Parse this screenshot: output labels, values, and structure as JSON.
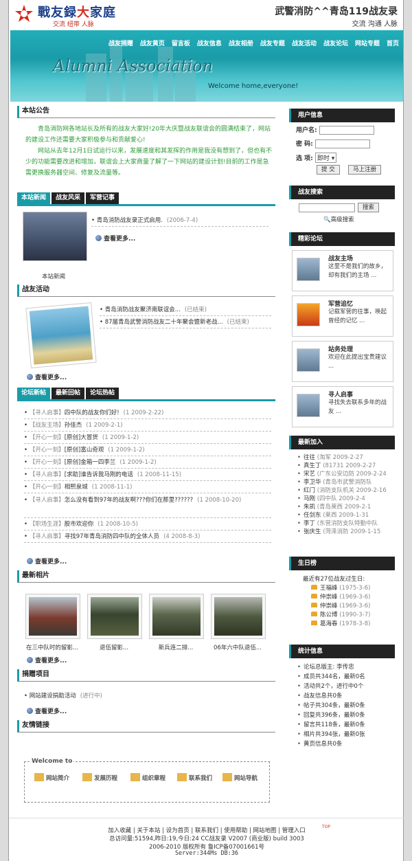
{
  "header": {
    "logo_main": "戰友録",
    "logo_accent": "大",
    "logo_end": "家庭",
    "logo_sub": "交流  纽带  人脉",
    "site_title": "武警消防^^青岛119战友录",
    "site_sub": "交流 沟通 人脉"
  },
  "nav": [
    "战友捐赠",
    "战友黄页",
    "留言板",
    "战友信息",
    "战友相册",
    "战友专题",
    "战友活动",
    "战友论坛",
    "网站专题",
    "首页"
  ],
  "banner": {
    "title": "Alumni Association",
    "welcome": "Welcome home,everyone!"
  },
  "notice": {
    "title": "本站公告",
    "p1": "青岛消防网各地站长及所有的战友大家好!20年大庆暨战友联谊会的圆满结束了，网站的建设工作还需要大家积极参与和贡献爱心!",
    "p2": "网站从去年12月1日试运行以来，发展速度和其发挥的作用是我没有想到了，但也有不少的功能需要改进和增加，联谊会上大家商量了解了一下网站的建设计划!目前的工作是急需更换服务器空间、修复及流量等。"
  },
  "news_tabs": [
    "本站新闻",
    "战友风采",
    "军营记事"
  ],
  "news": {
    "items": [
      {
        "text": "青岛消防战友录正式启用.",
        "date": "(2006-7-4)"
      }
    ],
    "more": "查看更多...",
    "img_caption": "本站新闻"
  },
  "activity": {
    "title": "战友活动",
    "items": [
      {
        "text": "青岛消防战友聚济南联谊会...",
        "status": "(已结束)"
      },
      {
        "text": "87届青岛武警消防战友二十年聚会暨新老战...",
        "status": "(已结束)"
      }
    ],
    "more": "查看更多..."
  },
  "forum_tabs": [
    "论坛新帖",
    "最新回帖",
    "论坛热帖"
  ],
  "forum": {
    "items": [
      {
        "cat": "【寻人启事】",
        "text": "四中队的战友你们好!",
        "date": "(1 2009-2-22)"
      },
      {
        "cat": "【战友主场】",
        "text": "孙佳杰",
        "date": "(1 2009-2-1)"
      },
      {
        "cat": "【开心一刻】",
        "text": "[原创]大冒货",
        "date": "(1 2009-1-2)"
      },
      {
        "cat": "【开心一刻】",
        "text": "[原创]富山奇观",
        "date": "(1 2009-1-2)"
      },
      {
        "cat": "【开心一刻】",
        "text": "[原创]金箱一四李兰",
        "date": "(1 2009-1-2)"
      },
      {
        "cat": "【寻人启事】",
        "text": "[求助]谁告诉我马刚的电话",
        "date": "(1 2008-11-15)"
      },
      {
        "cat": "【开心一刻】",
        "text": "相熙泉城",
        "date": "(1 2008-11-1)"
      },
      {
        "cat": "【寻人启事】",
        "text": "怎么没有看到97年的战友啊???你们在那里??????",
        "date": "(1 2008-10-20)"
      },
      {
        "cat": "【职场生涯】",
        "text": "股市欢迎你",
        "date": "(1 2008-10-5)"
      },
      {
        "cat": "【寻人启事】",
        "text": "寻找97年青岛消防四中队的全体人员",
        "date": "(4 2008-8-3)"
      }
    ],
    "more": "查看更多..."
  },
  "photos": {
    "title": "最新相片",
    "items": [
      "在三中队时的留影...",
      "退伍留影...",
      "新兵连二排...",
      "06年六中队退伍..."
    ],
    "more": "查看更多..."
  },
  "donation": {
    "title": "捐赠项目",
    "items": [
      {
        "text": "网站建设捐助活动",
        "status": "(进行中)"
      }
    ],
    "more": "查看更多..."
  },
  "links": {
    "title": "友情链接"
  },
  "welcome": {
    "title": "Welcome to",
    "items": [
      "网站简介",
      "发展历程",
      "组织章程",
      "联系我们",
      "网站导航"
    ]
  },
  "user": {
    "title": "用户信息",
    "username_label": "用户名:",
    "password_label": "密  码:",
    "option_label": "选  项:",
    "option_value": "即时",
    "login": "提 交",
    "register": "马上注册"
  },
  "search": {
    "title": "战友搜索",
    "button": "搜索",
    "advanced": "高级搜索"
  },
  "forums": {
    "title": "精彩论坛",
    "items": [
      {
        "name": "战友主场",
        "desc": "这里不是我们的故乡，却有我们的主场 ..."
      },
      {
        "name": "军营追忆",
        "desc": "记载军营的往事，唤起曾经的记忆 ..."
      },
      {
        "name": "站务处理",
        "desc": "欢迎在此提出宝贵建议 ..."
      },
      {
        "name": "寻人启事",
        "desc": "寻找失去联系多年的战友 ..."
      }
    ]
  },
  "newest": {
    "title": "最新加入",
    "items": [
      {
        "name": "往往",
        "info": "(淘军 2009-2-27"
      },
      {
        "name": "真生丁",
        "info": "(81731 2009-2-27"
      },
      {
        "name": "宋艺",
        "info": "(广东公安边防 2009-2-24"
      },
      {
        "name": "李卫华",
        "info": "(青岛市武警消防队"
      },
      {
        "name": "红门",
        "info": "(消防支队机关 2009-2-16"
      },
      {
        "name": "马刚",
        "info": "(四中队 2009-2-4"
      },
      {
        "name": "朱凯",
        "info": "(青岛莱西 2009-2-1"
      },
      {
        "name": "任剑东",
        "info": "(莱西 2009-1-31"
      },
      {
        "name": "李丁",
        "info": "(东营消防支队特勤中队"
      },
      {
        "name": "张庆生",
        "info": "(菏泽消防 2009-1-15"
      }
    ]
  },
  "birthday": {
    "title": "生日榜",
    "intro": "最近有27位战友过生日:",
    "items": [
      {
        "name": "王福峰",
        "date": "(1975-3-6)"
      },
      {
        "name": "仲崇峰",
        "date": "(1969-3-6)"
      },
      {
        "name": "仲崇峰",
        "date": "(1969-3-6)"
      },
      {
        "name": "陈公博",
        "date": "(1990-3-7)"
      },
      {
        "name": "葛海春",
        "date": "(1978-3-8)"
      }
    ]
  },
  "stats": {
    "title": "统计信息",
    "items": [
      "论坛总版主: 李传忠",
      "成员共344名，最新0名",
      "活动共2个，进行中0个",
      "战友信息共0条",
      "帖子共304条，最新0条",
      "回复共396条，最新0条",
      "留言共118条，最新0条",
      "相片共394张，最新0张",
      "黄页信息共0条"
    ]
  },
  "footer": {
    "links": "加入收藏 | 关于本站 | 设为首页 | 联系我们 | 使用帮助 | 网站地图 | 管理入口",
    "count": "总访问量:51594,昨日:19,今日:24 CC战友录 V2007 (商业版) build 3003",
    "copy": "2006-2010 版权所有 鲁ICP备07001661号",
    "server": "Server:344Ms  DB:36",
    "top": "TOP"
  }
}
